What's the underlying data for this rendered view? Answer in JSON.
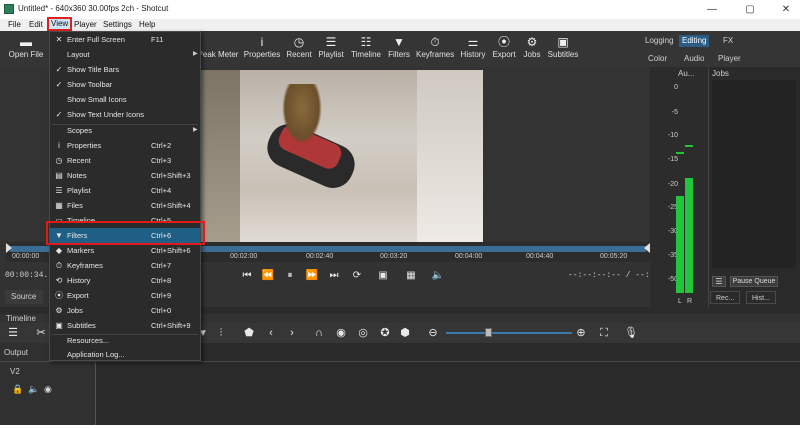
{
  "window": {
    "title": "Untitled* - 640x360 30.00fps 2ch - Shotcut",
    "minimize": "—",
    "maximize": "▢",
    "close": "✕"
  },
  "menubar": {
    "items": [
      "File",
      "Edit",
      "View",
      "Player",
      "Settings",
      "Help"
    ]
  },
  "toolbar": {
    "open_file": "Open File",
    "peak_meter": "Peak Meter",
    "properties": "Properties",
    "recent": "Recent",
    "playlist": "Playlist",
    "timeline": "Timeline",
    "filters": "Filters",
    "keyframes": "Keyframes",
    "history": "History",
    "export": "Export",
    "jobs": "Jobs",
    "subtitles": "Subtitles"
  },
  "layouts": {
    "logging": "Logging",
    "editing": "Editing",
    "fx": "FX",
    "color": "Color",
    "audio": "Audio",
    "player": "Player"
  },
  "view_menu": {
    "items": [
      {
        "label": "Enter Full Screen",
        "shortcut": "F11",
        "check": "✕",
        "arrow": ""
      },
      {
        "label": "Layout",
        "shortcut": "",
        "check": "",
        "arrow": "▶"
      },
      {
        "label": "Show Title Bars",
        "shortcut": "",
        "check": "✓",
        "arrow": ""
      },
      {
        "label": "Show Toolbar",
        "shortcut": "",
        "check": "✓",
        "arrow": ""
      },
      {
        "label": "Show Small Icons",
        "shortcut": "",
        "check": "",
        "arrow": ""
      },
      {
        "label": "Show Text Under Icons",
        "shortcut": "",
        "check": "✓",
        "arrow": ""
      },
      {
        "label": "Scopes",
        "shortcut": "",
        "check": "",
        "arrow": "▶"
      },
      {
        "label": "Properties",
        "shortcut": "Ctrl+2",
        "check": "i",
        "arrow": ""
      },
      {
        "label": "Recent",
        "shortcut": "Ctrl+3",
        "check": "◷",
        "arrow": ""
      },
      {
        "label": "Notes",
        "shortcut": "Ctrl+Shift+3",
        "check": "▤",
        "arrow": ""
      },
      {
        "label": "Playlist",
        "shortcut": "Ctrl+4",
        "check": "☰",
        "arrow": ""
      },
      {
        "label": "Files",
        "shortcut": "Ctrl+Shift+4",
        "check": "▦",
        "arrow": ""
      },
      {
        "label": "Timeline",
        "shortcut": "Ctrl+5",
        "check": "▭",
        "arrow": ""
      },
      {
        "label": "Filters",
        "shortcut": "Ctrl+6",
        "check": "▼",
        "arrow": ""
      },
      {
        "label": "Markers",
        "shortcut": "Ctrl+Shift+6",
        "check": "◆",
        "arrow": ""
      },
      {
        "label": "Keyframes",
        "shortcut": "Ctrl+7",
        "check": "⏱",
        "arrow": ""
      },
      {
        "label": "History",
        "shortcut": "Ctrl+8",
        "check": "⟲",
        "arrow": ""
      },
      {
        "label": "Export",
        "shortcut": "Ctrl+9",
        "check": "⦿",
        "arrow": ""
      },
      {
        "label": "Jobs",
        "shortcut": "Ctrl+0",
        "check": "⚙",
        "arrow": ""
      },
      {
        "label": "Subtitles",
        "shortcut": "Ctrl+Shift+9",
        "check": "▣",
        "arrow": ""
      },
      {
        "label": "Resources...",
        "shortcut": "",
        "check": "",
        "arrow": ""
      },
      {
        "label": "Application Log...",
        "shortcut": "",
        "check": "",
        "arrow": ""
      }
    ]
  },
  "scrubber": {
    "ticks": [
      "00:00:00",
      "00:02:00",
      "00:02:40",
      "00:03:20",
      "00:04:00",
      "00:04:40",
      "00:05:20"
    ]
  },
  "player": {
    "timecode": "00:00:34.",
    "duration": "--:--:--:-- / --:--:--:--"
  },
  "panels": {
    "source_tab": "Source",
    "timeline_title": "Timeline",
    "output_label": "Output",
    "track_v2": "V2"
  },
  "audio": {
    "title": "Au...",
    "db_labels": [
      "0",
      "-5",
      "-10",
      "-15",
      "-20",
      "-25",
      "-30",
      "-35",
      "-40",
      "-45",
      "-50"
    ],
    "left": "L",
    "right": "R"
  },
  "jobs": {
    "title": "Jobs",
    "menu_icon": "☰",
    "pause_queue": "Pause Queue",
    "tab_recent": "Rec...",
    "tab_history": "Hist..."
  },
  "colors": {
    "menu_highlight": "#1f5f86",
    "annotation_red": "#e01b1b",
    "meter_green": "#22c63a",
    "accent_blue": "#2b5c86"
  }
}
